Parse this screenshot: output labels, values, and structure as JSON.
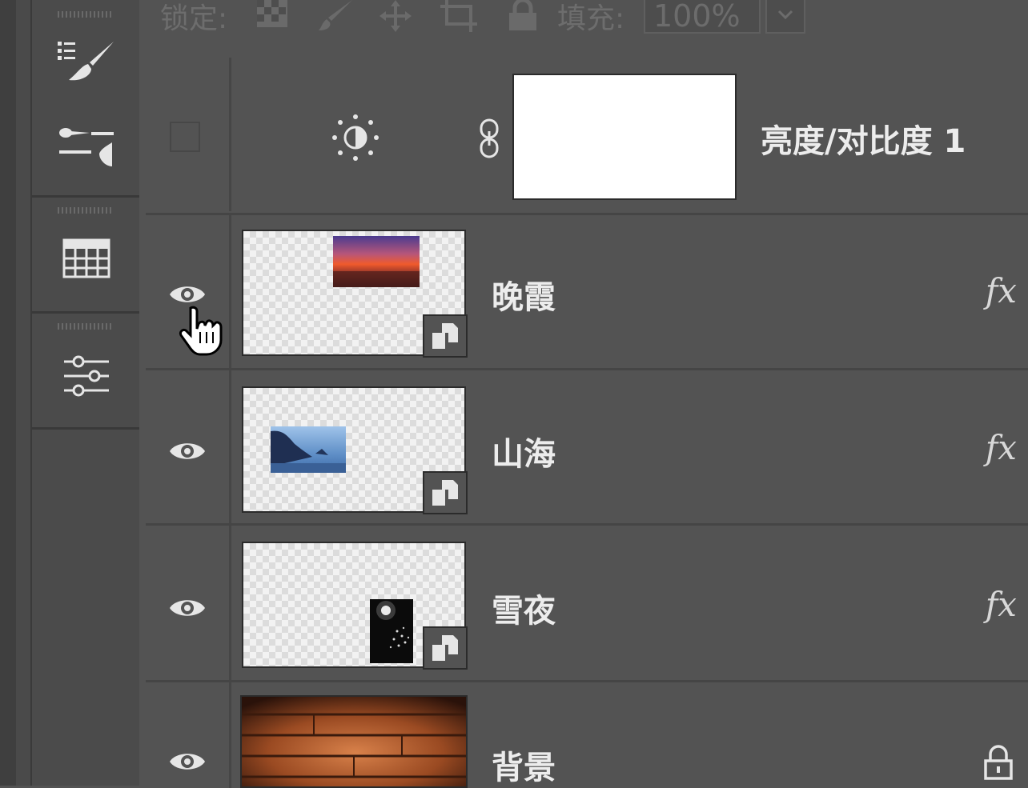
{
  "lock_bar": {
    "lock_label": "锁定:",
    "fill_label": "填充:",
    "fill_value": "100%"
  },
  "tools": [
    {
      "icon": "brush-presets-icon"
    },
    {
      "icon": "brush-settings-icon"
    },
    {
      "icon": "swatches-grid-icon"
    },
    {
      "icon": "adjustments-sliders-icon"
    }
  ],
  "layers": [
    {
      "name": "亮度/对比度 1",
      "type": "adjustment",
      "visible": false,
      "icon": "brightness-contrast-icon",
      "has_fx": false
    },
    {
      "name": "晚霞",
      "type": "smart-object",
      "visible": true,
      "has_fx": true,
      "fx_label": "fx"
    },
    {
      "name": "山海",
      "type": "smart-object",
      "visible": true,
      "has_fx": true,
      "fx_label": "fx"
    },
    {
      "name": "雪夜",
      "type": "smart-object",
      "visible": true,
      "has_fx": true,
      "fx_label": "fx"
    },
    {
      "name": "背景",
      "type": "background",
      "visible": true,
      "locked": true
    }
  ]
}
